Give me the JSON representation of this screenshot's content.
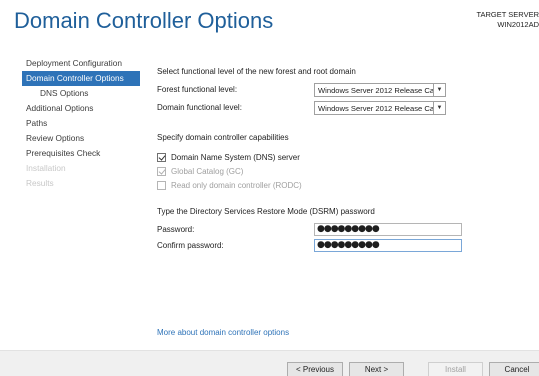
{
  "header": {
    "title": "Domain Controller Options",
    "target_label": "TARGET SERVER",
    "target_value": "WIN2012AD"
  },
  "sidebar": {
    "items": [
      {
        "label": "Deployment Configuration"
      },
      {
        "label": "Domain Controller Options"
      },
      {
        "label": "DNS Options"
      },
      {
        "label": "Additional Options"
      },
      {
        "label": "Paths"
      },
      {
        "label": "Review Options"
      },
      {
        "label": "Prerequisites Check"
      },
      {
        "label": "Installation"
      },
      {
        "label": "Results"
      }
    ]
  },
  "main": {
    "functional_heading": "Select functional level of the new forest and root domain",
    "forest_label": "Forest functional level:",
    "forest_value": "Windows Server 2012 Release Ca",
    "domain_label": "Domain functional level:",
    "domain_value": "Windows Server 2012 Release Ca",
    "capabilities_heading": "Specify domain controller capabilities",
    "dns_label": "Domain Name System (DNS) server",
    "gc_label": "Global Catalog (GC)",
    "rodc_label": "Read only domain controller (RODC)",
    "dsrm_heading": "Type the Directory Services Restore Mode (DSRM) password",
    "password_label": "Password:",
    "password_value": "●●●●●●●●●",
    "confirm_label": "Confirm password:",
    "confirm_value": "●●●●●●●●●",
    "more_link": "More about domain controller options"
  },
  "footer": {
    "previous": "< Previous",
    "next": "Next >",
    "install": "Install",
    "cancel": "Cancel"
  },
  "colors": {
    "title": "#1f5f9a",
    "accent": "#2e73b8"
  }
}
